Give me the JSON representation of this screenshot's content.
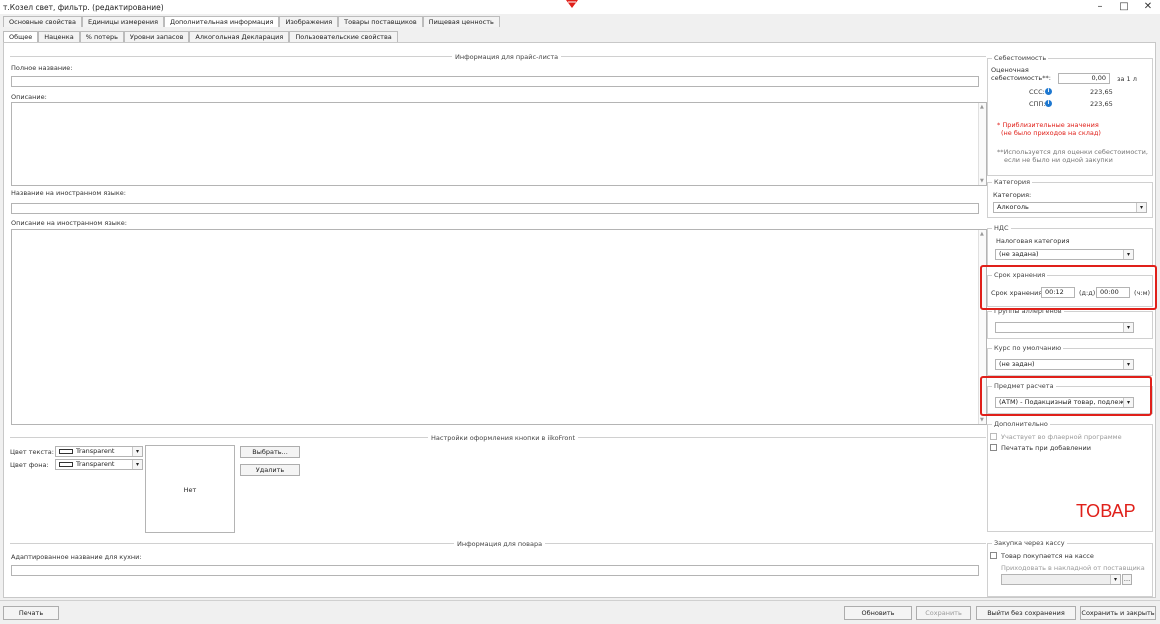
{
  "window": {
    "title": "т.Козел свет, фильтр. (редактирование)",
    "minimize": "–",
    "maximize": "□",
    "close": "✕"
  },
  "main_tabs": [
    "Основные свойства",
    "Единицы измерения",
    "Дополнительная информация",
    "Изображения",
    "Товары поставщиков",
    "Пищевая ценность"
  ],
  "sub_tabs": [
    "Общее",
    "Наценка",
    "% потерь",
    "Уровни запасов",
    "Алкогольная Декларация",
    "Пользовательские свойства"
  ],
  "price_info": {
    "group_title": "Информация для прайс-листа",
    "full_name_label": "Полное название:",
    "full_name_value": "",
    "description_label": "Описание:",
    "foreign_name_label": "Название на иностранном языке:",
    "foreign_desc_label": "Описание на иностранном языке:"
  },
  "button_design": {
    "group_title": "Настройки оформления кнопки в iikoFront",
    "text_color_label": "Цвет текста:",
    "text_color_value": "Transparent",
    "bg_color_label": "Цвет фона:",
    "bg_color_value": "Transparent",
    "preview_text": "Нет",
    "choose_button": "Выбрать...",
    "delete_button": "Удалить"
  },
  "cook_info": {
    "group_title": "Информация для повара",
    "kitchen_name_label": "Адаптированное название для кухни:"
  },
  "cost": {
    "title": "Себестоимость",
    "estimated_label_1": "Оценочная",
    "estimated_label_2": "себестоимость**:",
    "estimated_value": "0,00",
    "per_unit": "за 1 л",
    "ccc_label": "ССС:",
    "ccc_value": "223,65",
    "spp_label": "СПП:",
    "spp_value": "223,65",
    "approx_note_1": "* Приблизительные значения",
    "approx_note_2": "(не было приходов на склад)",
    "usage_note_1": "**Используется для оценки себестоимости,",
    "usage_note_2": "если не было ни одной закупки"
  },
  "category": {
    "title": "Категория",
    "label": "Категория:",
    "value": "Алкоголь"
  },
  "vat": {
    "title": "НДС",
    "label": "Налоговая категория",
    "value": "(не задана)"
  },
  "shelf_life": {
    "title": "Срок хранения",
    "label": "Срок хранения:",
    "value1": "00:12",
    "unit1": "(д:д)",
    "value2": "00:00",
    "unit2": "(ч:м)"
  },
  "allergens": {
    "title": "Группы аллергенов",
    "value": ""
  },
  "rate": {
    "title": "Курс по умолчанию",
    "value": "(не задан)"
  },
  "calc_subject": {
    "title": "Предмет расчета",
    "value": "(АТМ) - Подакцизный товар, подлежа..."
  },
  "additional": {
    "title": "Дополнительно",
    "flyer": "Участвует во флаерной программе",
    "print_on_add": "Печатать при добавлении",
    "badge": "ТОВАР"
  },
  "cashbox": {
    "title": "Закупка через кассу",
    "buy_at_cashbox": "Товар покупается на кассе",
    "receive_label": "Приходовать в накладной от поставщика"
  },
  "footer": {
    "print": "Печать",
    "refresh": "Обновить",
    "save": "Сохранить",
    "exit_no_save": "Выйти без сохранения",
    "save_close": "Сохранить и закрыть"
  },
  "colors": {
    "accent_red": "#e0201a",
    "info_blue": "#1e78d0"
  }
}
